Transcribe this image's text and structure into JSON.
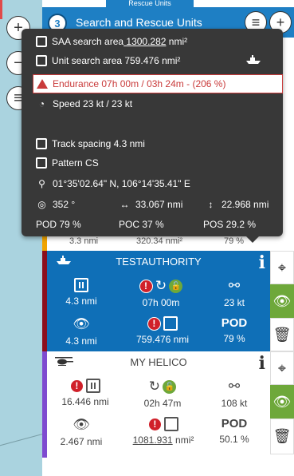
{
  "header": {
    "tab_label": "Rescue Units",
    "count": "3",
    "title": "Search and Rescue Units",
    "menu_icon": "≡",
    "add_icon": "+"
  },
  "map_controls": {
    "zoom_in": "+",
    "zoom_out": "−",
    "layers": "≡"
  },
  "tooltip": {
    "saa_label": "SAA search area",
    "saa_value": " 1300.282",
    "saa_unit": " nmi²",
    "unit_area": "Unit search area 759.476 nmi²",
    "endurance": "Endurance 07h 00m / 03h 24m - (206 %)",
    "speed": "Speed 23 kt / 23 kt",
    "track_spacing": "Track spacing 4.3 nmi",
    "pattern": "Pattern CS",
    "position": "01°35'02.64\" N, 106°14'35.41\" E",
    "course": "352 °",
    "width": "33.067 nmi",
    "length": "22.968 nmi",
    "pod": "POD 79 %",
    "poc": "POC 37 %",
    "pos": "POS 29.2 %"
  },
  "peek_row": {
    "c1": "3.3 nmi",
    "c2": "320.34 nmi²",
    "c3": "79 %"
  },
  "units": [
    {
      "name": "TESTAUTHORITY",
      "info": "i",
      "track": "4.3 nmi",
      "endurance": "07h 00m",
      "speed": "23 kt",
      "sweep": "4.3 nmi",
      "area": "759.476 nmi",
      "pod_label": "POD",
      "pod": "79 %"
    },
    {
      "name": "MY HELICO",
      "info": "i",
      "track": "16.446 nmi",
      "endurance": "02h 47m",
      "speed": "108 kt",
      "sweep": "2.467 nmi",
      "area": "1081.931",
      "area_unit": " nmi²",
      "pod_label": "POD",
      "pod": "50.1 %"
    }
  ],
  "colors": {
    "brand_blue": "#1e7fc4",
    "unit_blue": "#0f6fb7",
    "alert_red": "#d0202a",
    "ok_green": "#6ea83a",
    "tooltip_bg": "#383838"
  }
}
